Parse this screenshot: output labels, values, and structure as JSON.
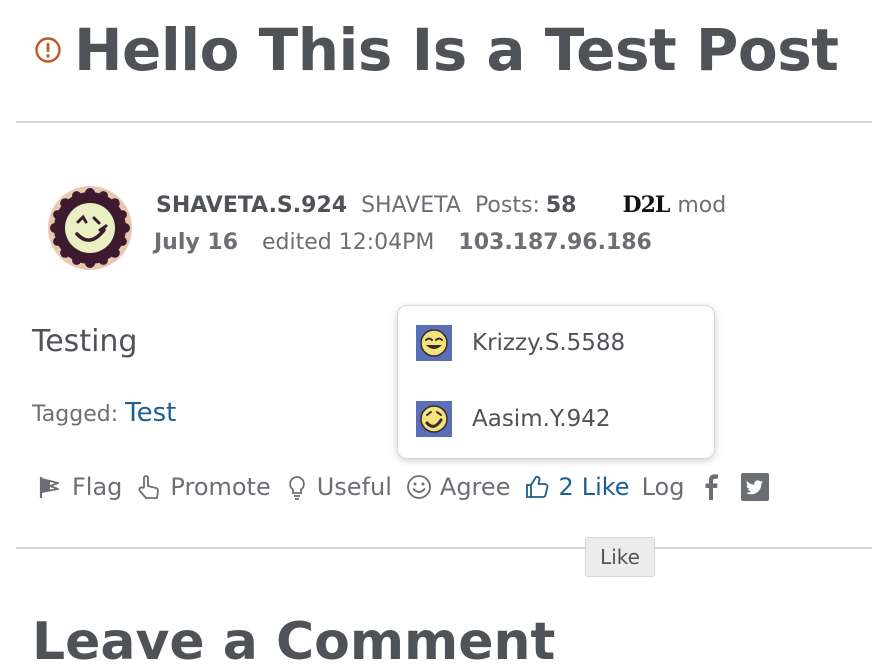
{
  "post": {
    "title": "Hello This Is a Test Post",
    "body": "Testing",
    "tagged_label": "Tagged:",
    "tag": "Test"
  },
  "author": {
    "username": "SHAVETA.S.924",
    "display_name": "SHAVETA",
    "posts_label": "Posts:",
    "posts_count": "58",
    "logo_text": "D2L",
    "role": "mod",
    "date": "July 16",
    "edited": "edited 12:04PM",
    "ip": "103.187.96.186"
  },
  "reactions": {
    "flag": "Flag",
    "promote": "Promote",
    "useful": "Useful",
    "agree": "Agree",
    "like_count": "2",
    "like": "Like",
    "log": "Log"
  },
  "likers_popup": {
    "users": [
      "Krizzy.S.5588",
      "Aasim.Y.942"
    ]
  },
  "tooltip": "Like",
  "comment_heading": "Leave a Comment",
  "icons": {
    "title_status": "alert-circle-icon",
    "social": [
      "facebook-icon",
      "twitter-icon"
    ]
  },
  "colors": {
    "link": "#1f5d8e",
    "alert": "#c0591f",
    "avatar_ring": "#e8c9b0",
    "avatar_dark": "#3d1a2e",
    "avatar_face": "#e8f0c4",
    "popup_avatar_bg": "#5a6fb8",
    "popup_avatar_face": "#f2e37a"
  }
}
